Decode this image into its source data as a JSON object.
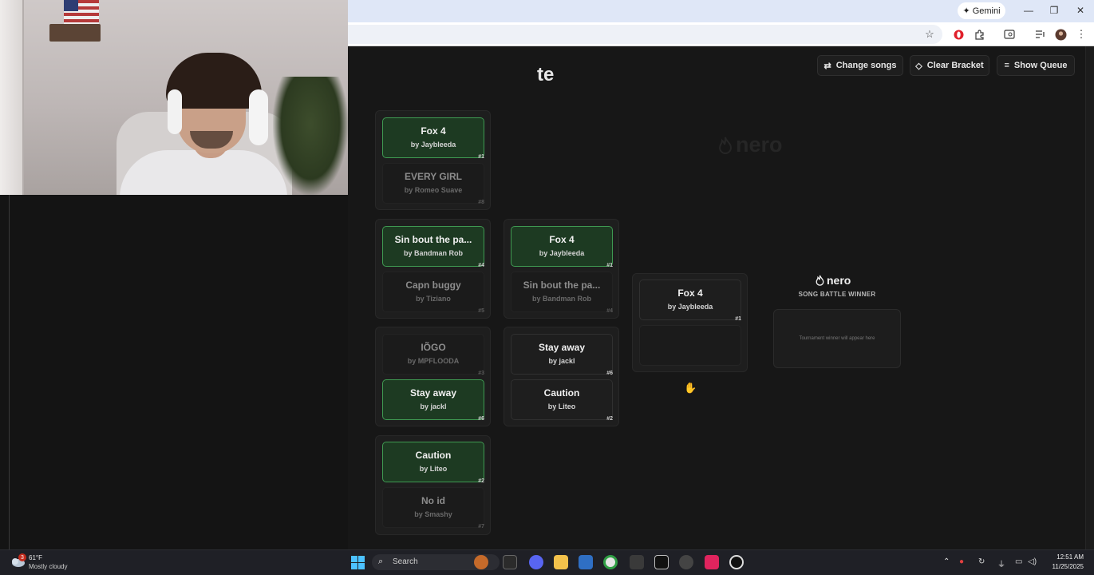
{
  "browser": {
    "gemini_label": "Gemini",
    "minimize": "—",
    "restore": "❐",
    "close": "✕"
  },
  "app": {
    "title": "te",
    "buttons": {
      "change_songs": "Change songs",
      "clear_bracket": "Clear Bracket",
      "show_queue": "Show Queue"
    },
    "watermark": "nero",
    "round1": [
      {
        "top": {
          "name": "Fox 4",
          "by": "by Jaybleeda",
          "seed": "#1",
          "state": "win"
        },
        "bottom": {
          "name": "EVERY GIRL",
          "by": "by Romeo Suave",
          "seed": "#8",
          "state": "lose"
        }
      },
      {
        "top": {
          "name": "Sin bout the pa...",
          "by": "by Bandman Rob",
          "seed": "#4",
          "state": "win"
        },
        "bottom": {
          "name": "Capn buggy",
          "by": "by Tiziano",
          "seed": "#5",
          "state": "lose"
        }
      },
      {
        "top": {
          "name": "IÕGO",
          "by": "by MPFLOODA",
          "seed": "#3",
          "state": "lose"
        },
        "bottom": {
          "name": "Stay away",
          "by": "by jackl",
          "seed": "#6",
          "state": "win"
        }
      },
      {
        "top": {
          "name": "Caution",
          "by": "by Liteo",
          "seed": "#2",
          "state": "win"
        },
        "bottom": {
          "name": "No id",
          "by": "by Smashy",
          "seed": "#7",
          "state": "lose"
        }
      }
    ],
    "round2": [
      {
        "top": {
          "name": "Fox 4",
          "by": "by Jaybleeda",
          "seed": "#1",
          "state": "win"
        },
        "bottom": {
          "name": "Sin bout the pa...",
          "by": "by Bandman Rob",
          "seed": "#4",
          "state": "lose"
        }
      },
      {
        "top": {
          "name": "Stay away",
          "by": "by jackl",
          "seed": "#6",
          "state": "norm"
        },
        "bottom": {
          "name": "Caution",
          "by": "by Liteo",
          "seed": "#2",
          "state": "norm"
        }
      }
    ],
    "final": {
      "top": {
        "name": "Fox 4",
        "by": "by Jaybleeda",
        "seed": "#1",
        "state": "norm"
      }
    },
    "winner": {
      "logo": "nero",
      "label": "SONG BATTLE WINNER",
      "placeholder": "Tournament winner will appear here"
    }
  },
  "taskbar": {
    "weather_badge": "3",
    "temperature": "61°F",
    "condition": "Mostly cloudy",
    "search_label": "Search",
    "time": "12:51 AM",
    "date": "11/25/2025"
  }
}
